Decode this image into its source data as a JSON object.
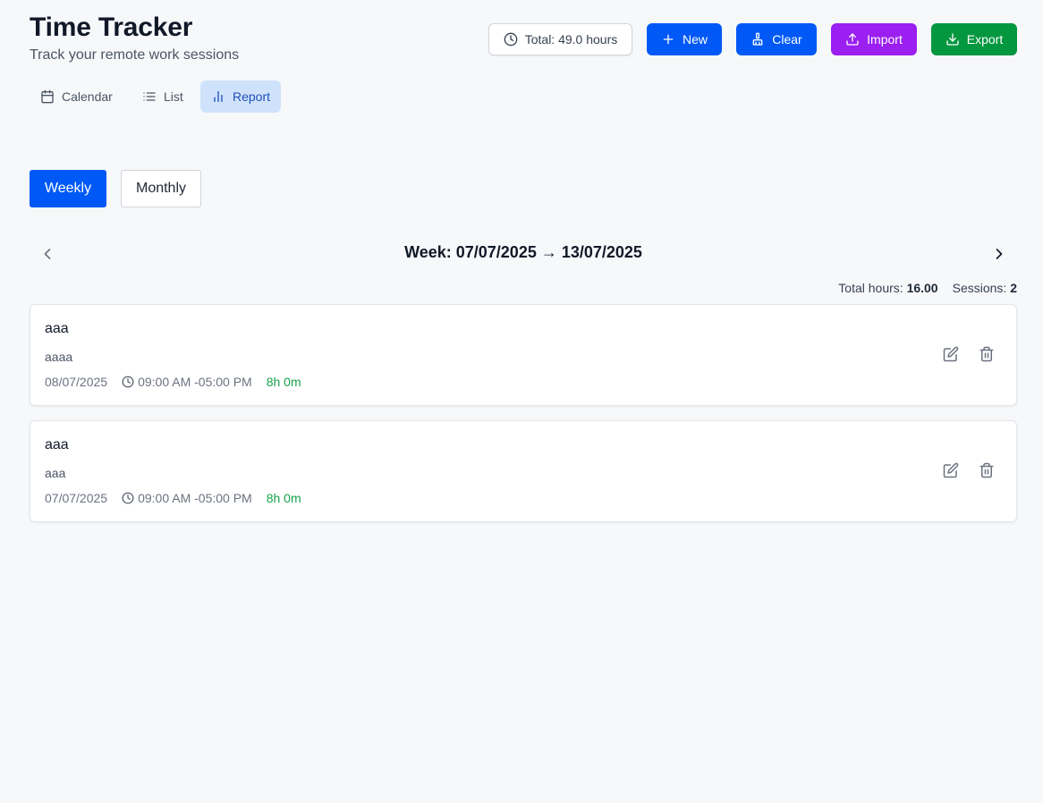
{
  "header": {
    "title": "Time Tracker",
    "subtitle": "Track your remote work sessions"
  },
  "toolbar": {
    "total_label": "Total: 49.0 hours",
    "new_label": "New",
    "clear_label": "Clear",
    "import_label": "Import",
    "export_label": "Export"
  },
  "view_tabs": [
    {
      "label": "Calendar",
      "icon": "calendar-icon",
      "active": false
    },
    {
      "label": "List",
      "icon": "list-icon",
      "active": false
    },
    {
      "label": "Report",
      "icon": "bar-chart-icon",
      "active": true
    }
  ],
  "period_toggle": {
    "weekly_label": "Weekly",
    "monthly_label": "Monthly",
    "selected": "Weekly"
  },
  "week_nav": {
    "label": "Week: 07/07/2025 → 13/07/2025"
  },
  "summary": {
    "total_hours_label": "Total hours:",
    "total_hours_value": "16.00",
    "sessions_label": "Sessions:",
    "sessions_value": "2"
  },
  "sessions": [
    {
      "title": "aaa",
      "description": "aaaa",
      "date": "08/07/2025",
      "time_range": "09:00 AM -05:00 PM",
      "duration": "8h 0m"
    },
    {
      "title": "aaa",
      "description": "aaa",
      "date": "07/07/2025",
      "time_range": "09:00 AM -05:00 PM",
      "duration": "8h 0m"
    }
  ],
  "colors": {
    "primary_blue": "#0059f7",
    "import_purple": "#9b1ff0",
    "export_green": "#03973f",
    "duration_green": "#16a34a",
    "active_tab_bg": "#cfe2fb"
  }
}
